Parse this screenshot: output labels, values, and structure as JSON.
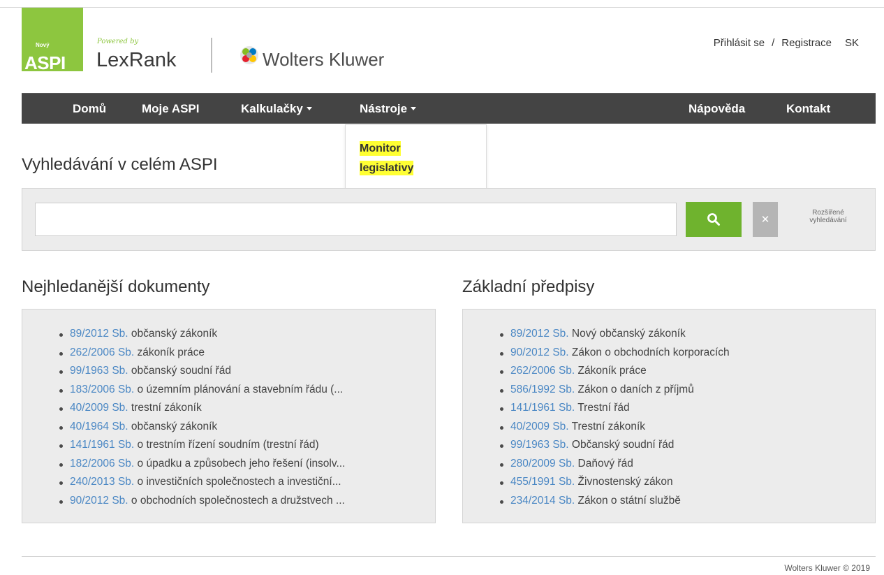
{
  "header": {
    "logo_novy": "Nový",
    "logo_aspi": "ASPI",
    "powered_by": "Powered by",
    "lexrank": "LexRank",
    "wolters_kluwer": "Wolters Kluwer",
    "login": "Přihlásit se",
    "separator": "/",
    "register": "Registrace",
    "language": "SK"
  },
  "nav": {
    "home": "Domů",
    "my_aspi": "Moje ASPI",
    "calculators": "Kalkulačky",
    "tools": "Nástroje",
    "help": "Nápověda",
    "contact": "Kontakt"
  },
  "dropdown": {
    "item": "Monitor legislativy"
  },
  "search": {
    "title": "Vyhledávání v celém ASPI",
    "input_value": "",
    "placeholder": "",
    "advanced": "Rozšířené vyhledávání"
  },
  "most_searched": {
    "title": "Nejhledanější dokumenty",
    "items": [
      {
        "code": "89/2012 Sb.",
        "text": "občanský zákoník"
      },
      {
        "code": "262/2006 Sb.",
        "text": "zákoník práce"
      },
      {
        "code": "99/1963 Sb.",
        "text": "občanský soudní řád"
      },
      {
        "code": "183/2006 Sb.",
        "text": "o územním plánování a stavebním řádu (..."
      },
      {
        "code": "40/2009 Sb.",
        "text": "trestní zákoník"
      },
      {
        "code": "40/1964 Sb.",
        "text": "občanský zákoník"
      },
      {
        "code": "141/1961 Sb.",
        "text": "o trestním řízení soudním (trestní řád)"
      },
      {
        "code": "182/2006 Sb.",
        "text": "o úpadku a způsobech jeho řešení (insolv..."
      },
      {
        "code": "240/2013 Sb.",
        "text": "o investičních společnostech a investiční..."
      },
      {
        "code": "90/2012 Sb.",
        "text": "o obchodních společnostech a družstvech ..."
      }
    ]
  },
  "basic_regulations": {
    "title": "Základní předpisy",
    "items": [
      {
        "code": "89/2012 Sb.",
        "text": "Nový občanský zákoník"
      },
      {
        "code": "90/2012 Sb.",
        "text": "Zákon o obchodních korporacích"
      },
      {
        "code": "262/2006 Sb.",
        "text": "Zákoník práce"
      },
      {
        "code": "586/1992 Sb.",
        "text": "Zákon o daních z příjmů"
      },
      {
        "code": "141/1961 Sb.",
        "text": "Trestní řád"
      },
      {
        "code": "40/2009 Sb.",
        "text": "Trestní zákoník"
      },
      {
        "code": "99/1963 Sb.",
        "text": "Občanský soudní řád"
      },
      {
        "code": "280/2009 Sb.",
        "text": "Daňový řád"
      },
      {
        "code": "455/1991 Sb.",
        "text": "Živnostenský zákon"
      },
      {
        "code": "234/2014 Sb.",
        "text": "Zákon o státní službě"
      }
    ]
  },
  "footer": {
    "copyright": "Wolters Kluwer © 2019"
  },
  "colors": {
    "brand_green": "#8dc63f",
    "nav_bg": "#444444",
    "link_blue": "#4a87c4",
    "highlight": "#ffff33"
  },
  "icons": {
    "search": "search-icon",
    "clear": "close-icon",
    "caret": "caret-down-icon"
  }
}
